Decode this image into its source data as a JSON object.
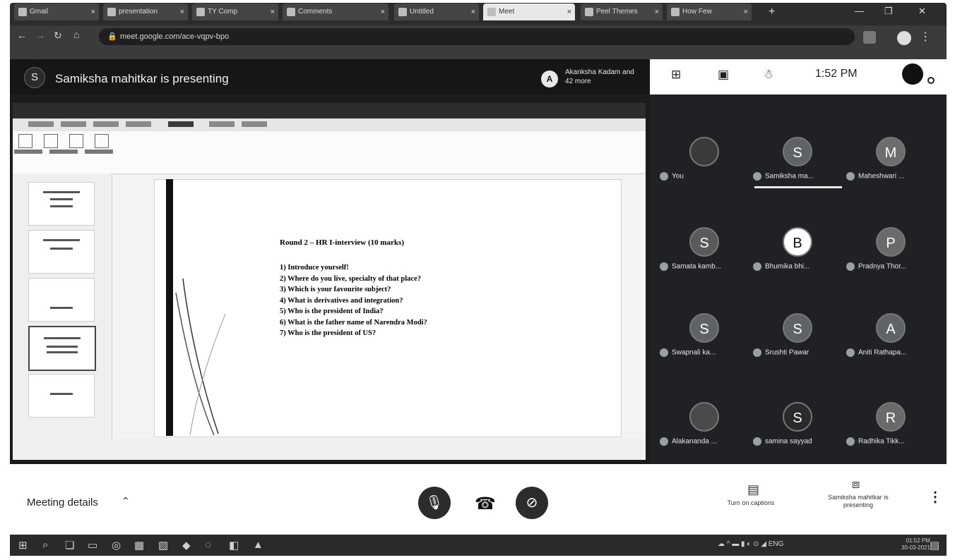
{
  "browser": {
    "tabs": [
      {
        "title": "Gmail"
      },
      {
        "title": "presentation"
      },
      {
        "title": "TY Comp"
      },
      {
        "title": "Comments"
      },
      {
        "title": "Untitled"
      },
      {
        "title": "Meet"
      },
      {
        "title": "Peel Themes"
      },
      {
        "title": "How Few"
      }
    ],
    "new_tab": "+",
    "window_controls": {
      "minimize": "—",
      "maximize": "❐",
      "close": "✕"
    },
    "url": "meet.google.com/ace-vqpv-bpo"
  },
  "meet": {
    "presenter_initial": "S",
    "presenting_text": "Samiksha mahitkar is presenting",
    "viewer_initial": "A",
    "viewer_text": "Akanksha Kadam and 42 more",
    "clock": "1:52 PM"
  },
  "slide": {
    "title": "Round 2 – HR I-interview (10 marks)",
    "questions": [
      "1)  Introduce yourself!",
      "2)  Where do you live, specialty of that place?",
      "3)  Which is your favourite subject?",
      "4)  What is derivatives and integration?",
      "5)  Who is the president of India?",
      "6)  What is the father name of Narendra Modi?",
      "7)  Who is the president of US?"
    ]
  },
  "participants": [
    {
      "initial": "",
      "name": "You",
      "color": "#3a3a3a"
    },
    {
      "initial": "S",
      "name": "Samiksha ma...",
      "color": "#5f6368"
    },
    {
      "initial": "M",
      "name": "Maheshwari ...",
      "color": "#6d6d6d"
    },
    {
      "initial": "S",
      "name": "Samata kamb...",
      "color": "#5a5a5a"
    },
    {
      "initial": "B",
      "name": "Bhumika bhi...",
      "color": "#ffffff"
    },
    {
      "initial": "P",
      "name": "Pradnya Thor...",
      "color": "#6a6a6a"
    },
    {
      "initial": "S",
      "name": "Swapnali ka...",
      "color": "#5f6368"
    },
    {
      "initial": "S",
      "name": "Srushti Pawar",
      "color": "#5f6368"
    },
    {
      "initial": "A",
      "name": "Aniti Rathapa...",
      "color": "#5f6368"
    },
    {
      "initial": "",
      "name": "Alakananda ...",
      "color": "#4a4a4a"
    },
    {
      "initial": "S",
      "name": "samina sayyad",
      "color": "#2a2a2a"
    },
    {
      "initial": "R",
      "name": "Radhika Tikk...",
      "color": "#6a6a6a"
    }
  ],
  "controls": {
    "meeting_details": "Meeting details",
    "captions_label": "Turn on captions",
    "presenting_label": "Samiksha mahitkar is presenting"
  },
  "taskbar": {
    "tray": "ENG",
    "time": "01:52 PM",
    "date": "30-03-2021"
  }
}
